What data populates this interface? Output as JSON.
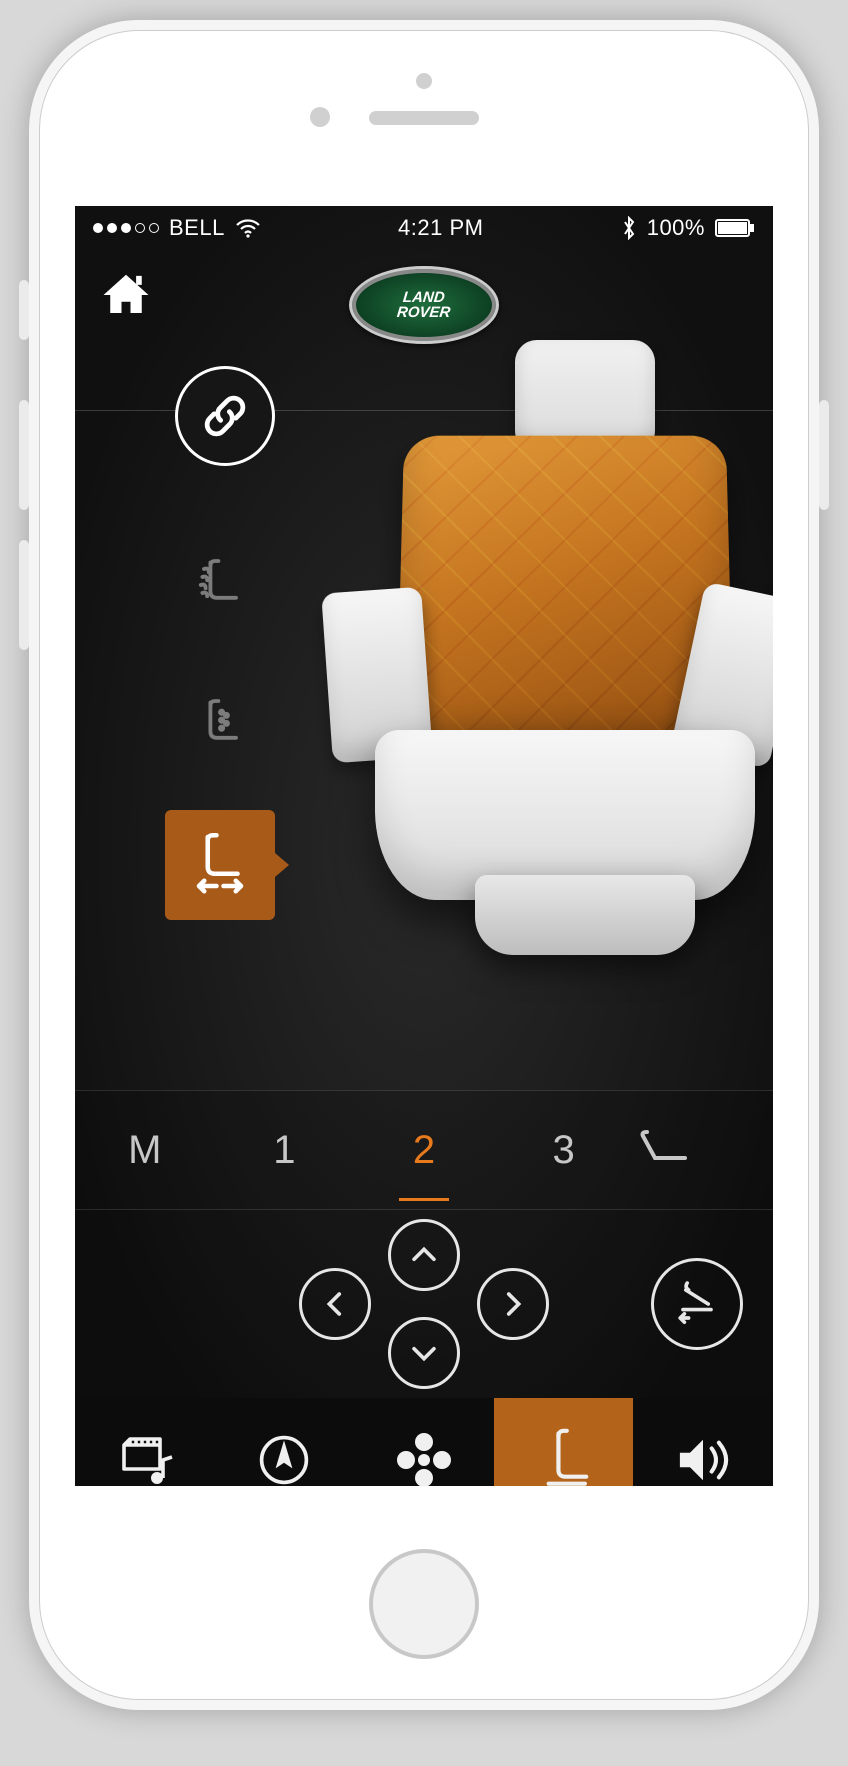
{
  "statusbar": {
    "carrier": "BELL",
    "signal_filled": 3,
    "signal_total": 5,
    "time": "4:21 PM",
    "battery_pct": "100%"
  },
  "logo": {
    "line1": "LAND",
    "line2": "ROVER"
  },
  "presets": {
    "memory_label": "M",
    "items": [
      "1",
      "2",
      "3"
    ],
    "active_index": 1
  },
  "colors": {
    "accent": "#b3641a",
    "active_text": "#e67a1c"
  }
}
